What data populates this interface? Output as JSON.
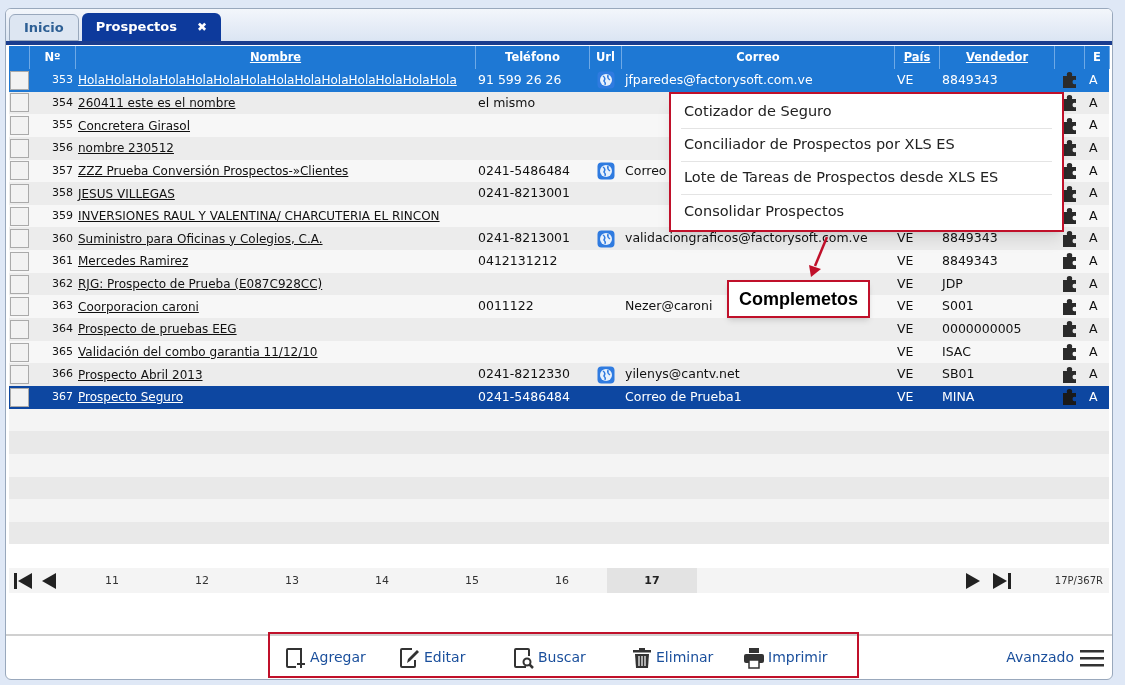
{
  "tabs": [
    {
      "label": "Inicio",
      "selected": false
    },
    {
      "label": "Prospectos",
      "selected": true,
      "close": "✖"
    }
  ],
  "table": {
    "columns": [
      {
        "label": "Nº",
        "sortable": false
      },
      {
        "label": "Nombre",
        "sortable": true
      },
      {
        "label": "Teléfono",
        "sortable": false
      },
      {
        "label": "Url",
        "sortable": false
      },
      {
        "label": "Correo",
        "sortable": false
      },
      {
        "label": "País",
        "sortable": true
      },
      {
        "label": "Vendedor",
        "sortable": true
      },
      {
        "label": "E",
        "sortable": false
      }
    ],
    "rows": [
      {
        "no": "353",
        "nombre": "HolaHolaHolaHolaHolaHolaHolaHolaHolaHolaHolaHolaHolaHola",
        "telefono": "91 599 26 26",
        "url": true,
        "correo": "jfparedes@factorysoft.com.ve",
        "pais": "VE",
        "vendedor": "8849343",
        "e": "A",
        "selected": false,
        "hover": true
      },
      {
        "no": "354",
        "nombre": "260411 este es el nombre",
        "telefono": "el mismo",
        "url": false,
        "e": "A",
        "selected": false,
        "hover": false
      },
      {
        "no": "355",
        "nombre": "Concretera Girasol",
        "url": false,
        "e": "A",
        "selected": false,
        "hover": false
      },
      {
        "no": "356",
        "nombre": "nombre 230512",
        "url": false,
        "e": "A",
        "selected": false,
        "hover": false
      },
      {
        "no": "357",
        "nombre": "ZZZ Prueba Conversión Prospectos-»Clientes",
        "telefono": "0241-5486484",
        "url": true,
        "correo": "Correo",
        "e": "A",
        "selected": false,
        "hover": false
      },
      {
        "no": "358",
        "nombre": "JESUS VILLEGAS",
        "telefono": "0241-8213001",
        "url": false,
        "e": "A",
        "selected": false,
        "hover": false
      },
      {
        "no": "359",
        "nombre": "INVERSIONES RAUL Y VALENTINA/ CHARCUTERIA EL RINCON",
        "url": false,
        "e": "A",
        "selected": false,
        "hover": false
      },
      {
        "no": "360",
        "nombre": "Suministro para Oficinas y Colegios, C.A.",
        "telefono": "0241-8213001",
        "url": true,
        "correo": "validaciongraficos@factorysoft.com.ve",
        "pais": "VE",
        "vendedor": "8849343",
        "e": "A",
        "selected": false,
        "hover": false
      },
      {
        "no": "361",
        "nombre": "Mercedes Ramirez",
        "telefono": "0412131212",
        "url": false,
        "pais": "VE",
        "vendedor": "8849343",
        "e": "A",
        "selected": false,
        "hover": false
      },
      {
        "no": "362",
        "nombre": "RJG: Prospecto de Prueba (E087C928CC)",
        "url": false,
        "pais": "VE",
        "vendedor": "JDP",
        "e": "A",
        "selected": false,
        "hover": false
      },
      {
        "no": "363",
        "nombre": "Coorporacion caroni",
        "telefono": "0011122",
        "url": false,
        "correo": "Nezer@caroni",
        "pais": "VE",
        "vendedor": "S001",
        "e": "A",
        "selected": false,
        "hover": false
      },
      {
        "no": "364",
        "nombre": "Prospecto de pruebas EEG",
        "url": false,
        "pais": "VE",
        "vendedor": "0000000005",
        "e": "A",
        "selected": false,
        "hover": false
      },
      {
        "no": "365",
        "nombre": "Validación del combo garantia 11/12/10",
        "url": false,
        "pais": "VE",
        "vendedor": "ISAC",
        "e": "A",
        "selected": false,
        "hover": false
      },
      {
        "no": "366",
        "nombre": "Prospecto Abril 2013",
        "telefono": "0241-8212330",
        "url": true,
        "correo": "yilenys@cantv.net",
        "pais": "VE",
        "vendedor": "SB01",
        "e": "A",
        "selected": false,
        "hover": false
      },
      {
        "no": "367",
        "nombre": "Prospecto Seguro",
        "telefono": "0241-5486484",
        "url": false,
        "correo": "Correo de Prueba1",
        "pais": "VE",
        "vendedor": "MINA",
        "e": "A",
        "selected": true,
        "hover": false
      }
    ]
  },
  "menu": {
    "items": [
      "Cotizador de Seguro",
      "Conciliador de Prospectos por XLS ES",
      "Lote de Tareas de Prospectos desde XLS ES",
      "Consolidar Prospectos"
    ]
  },
  "callout": "Complemetos",
  "pagination": {
    "pages": [
      {
        "label": "11",
        "selected": false
      },
      {
        "label": "12",
        "selected": false
      },
      {
        "label": "13",
        "selected": false
      },
      {
        "label": "14",
        "selected": false
      },
      {
        "label": "15",
        "selected": false
      },
      {
        "label": "16",
        "selected": false
      },
      {
        "label": "17",
        "selected": true
      }
    ],
    "summary": "17P/367R"
  },
  "toolbar": [
    {
      "kind": "add",
      "label": "Agregar"
    },
    {
      "kind": "edit",
      "label": "Editar"
    },
    {
      "kind": "search",
      "label": "Buscar"
    },
    {
      "kind": "delete",
      "label": "Eliminar"
    },
    {
      "kind": "print",
      "label": "Imprimir"
    }
  ],
  "advanced": "Avanzado"
}
